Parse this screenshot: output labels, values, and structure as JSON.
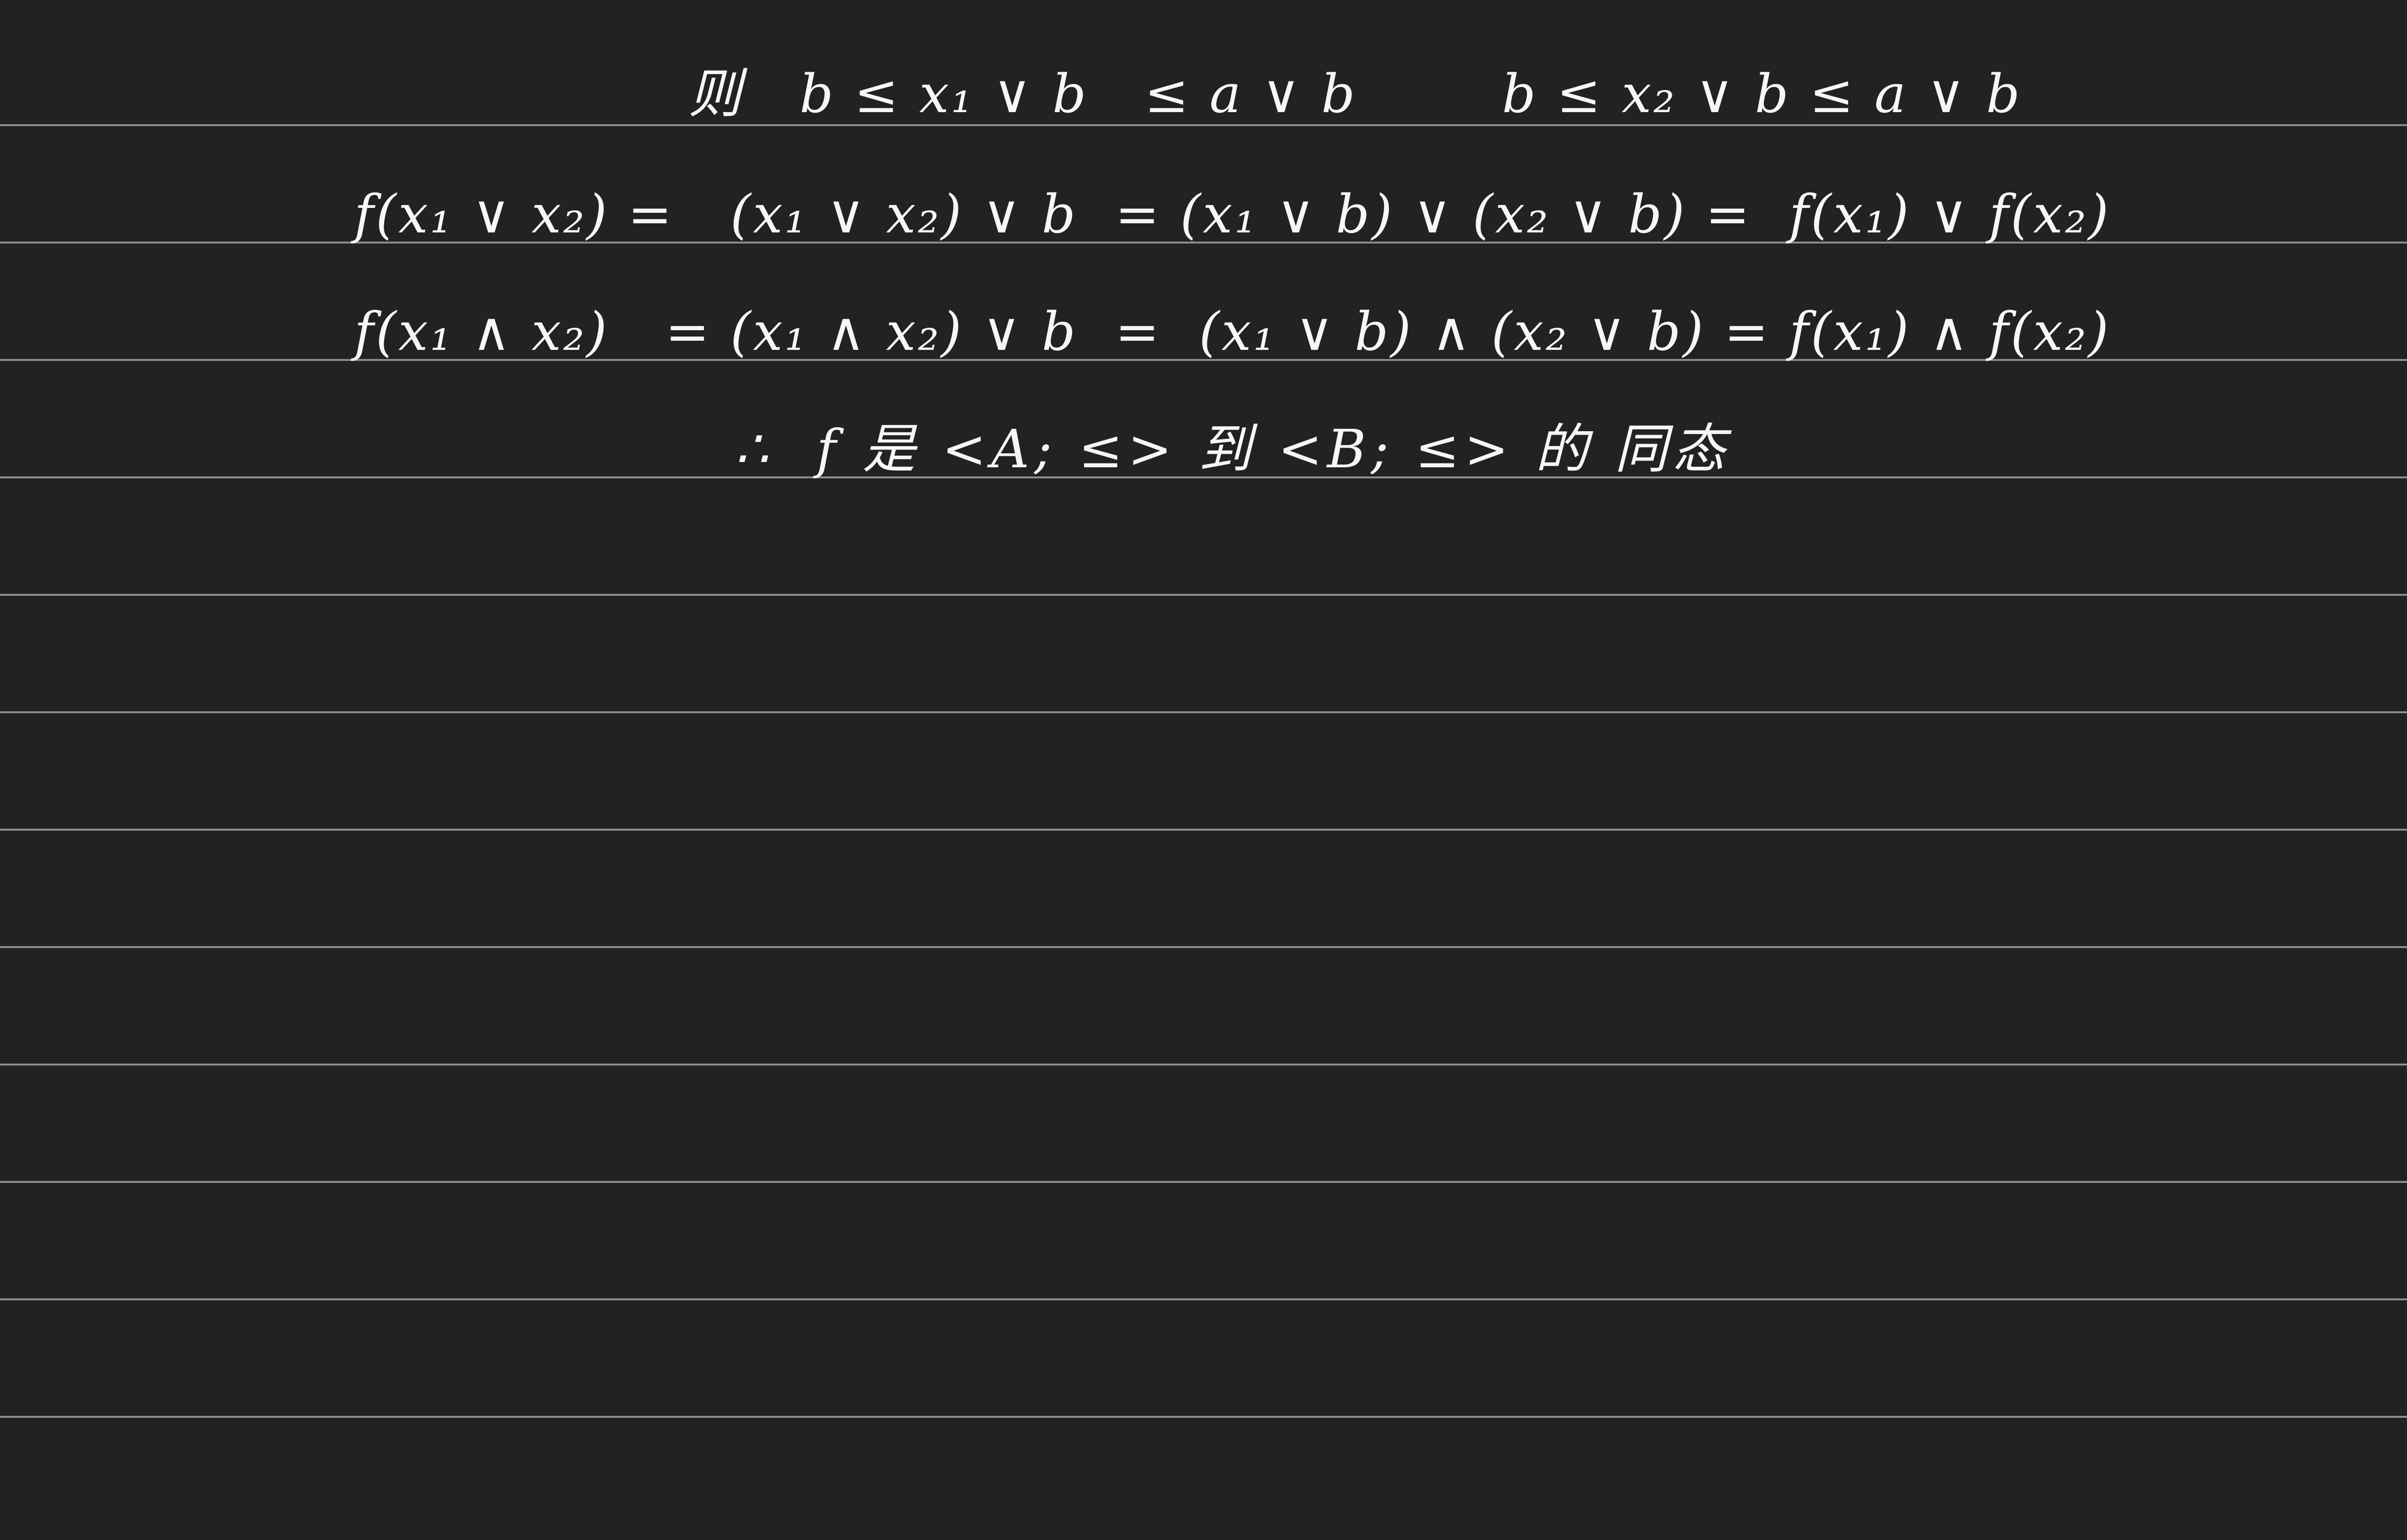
{
  "page": {
    "background_color": "#212224",
    "rule_color": "#8d8e90",
    "ink_color": "#f6f6f6"
  },
  "handwriting": {
    "line1": {
      "part1": "则   b ≤ x₁ ∨ b   ≤ a ∨ b",
      "part2": "b ≤ x₂ ∨ b ≤ a ∨ b"
    },
    "line2": "f(x₁ ∨ x₂) =   (x₁ ∨ x₂) ∨ b  = (x₁ ∨ b) ∨ (x₂ ∨ b) =  f(x₁) ∨ f(x₂)",
    "line3": "f(x₁ ∧ x₂)   = (x₁ ∧ x₂) ∨ b  =  (x₁ ∨ b) ∧ (x₂ ∨ b) = f(x₁) ∧ f(x₂)",
    "line4": "∴  f 是 <A; ≤> 到 <B; ≤> 的 同态"
  }
}
